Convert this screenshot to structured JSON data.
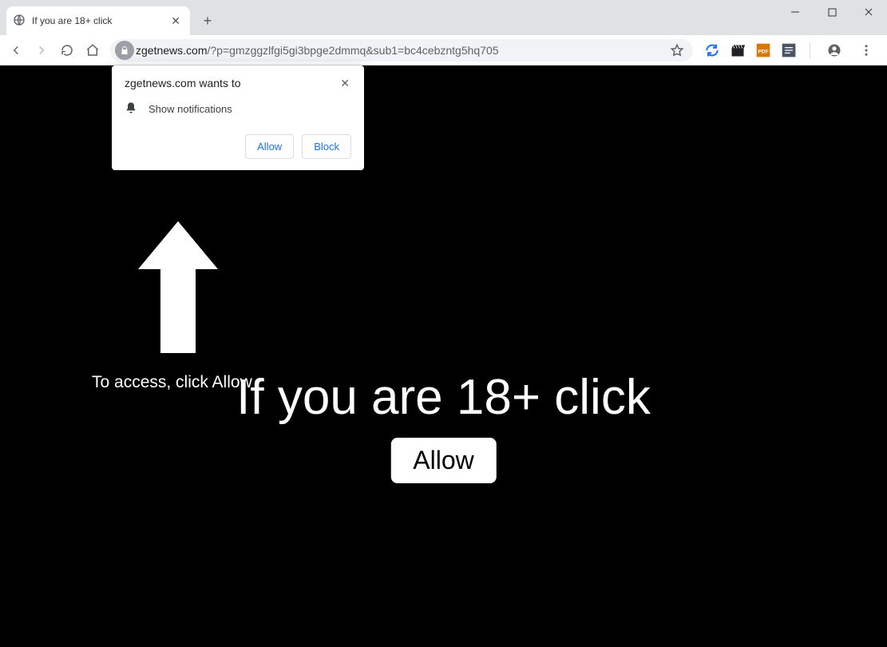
{
  "window": {
    "tab_title": "If you are 18+ click"
  },
  "addressbar": {
    "domain": "zgetnews.com",
    "path": "/?p=gmzggzlfgi5gi3bpge2dmmq&sub1=bc4cebzntg5hq705"
  },
  "permission": {
    "title": "zgetnews.com wants to",
    "body": "Show notifications",
    "allow": "Allow",
    "block": "Block"
  },
  "page": {
    "access_hint": "To access, click Allow",
    "headline": "If you are 18+ click",
    "allow_button": "Allow"
  }
}
